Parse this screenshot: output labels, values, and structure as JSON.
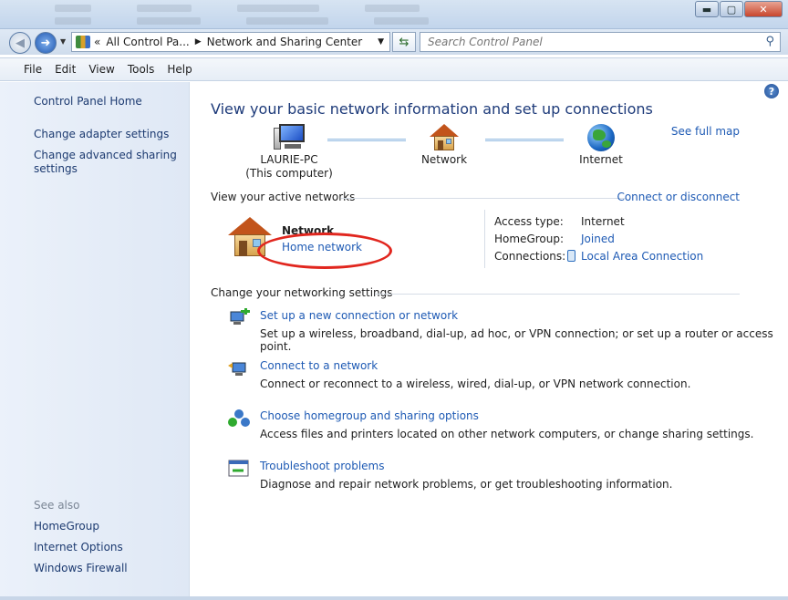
{
  "window": {
    "controls": {
      "minimize": "▬",
      "maximize": "▢",
      "close": "✕"
    }
  },
  "address": {
    "chevron": "«",
    "crumbs": [
      "All Control Pa...",
      "Network and Sharing Center"
    ],
    "search_placeholder": "Search Control Panel"
  },
  "menu": [
    "File",
    "Edit",
    "View",
    "Tools",
    "Help"
  ],
  "sidebar": {
    "home": "Control Panel Home",
    "adapter": "Change adapter settings",
    "advanced_line1": "Change advanced sharing",
    "advanced_line2": "settings",
    "see_also": "See also",
    "see_also_items": [
      "HomeGroup",
      "Internet Options",
      "Windows Firewall"
    ]
  },
  "main": {
    "heading": "View your basic network information and set up connections",
    "see_full_map": "See full map",
    "map": {
      "computer_name": "LAURIE-PC",
      "computer_sub": "(This computer)",
      "network": "Network",
      "internet": "Internet"
    },
    "active_networks_title": "View your active networks",
    "connect_or_disconnect": "Connect or disconnect",
    "active_network": {
      "name": "Network",
      "type": "Home network",
      "access_type_label": "Access type:",
      "access_type_value": "Internet",
      "homegroup_label": "HomeGroup:",
      "homegroup_value": "Joined",
      "connections_label": "Connections:",
      "connections_value": "Local Area Connection"
    },
    "settings_title": "Change your networking settings",
    "tasks": [
      {
        "link": "Set up a new connection or network",
        "desc": "Set up a wireless, broadband, dial-up, ad hoc, or VPN connection; or set up a router or access point.",
        "icon": "new-connection-icon"
      },
      {
        "link": "Connect to a network",
        "desc": "Connect or reconnect to a wireless, wired, dial-up, or VPN network connection.",
        "icon": "connect-network-icon"
      },
      {
        "link": "Choose homegroup and sharing options",
        "desc": "Access files and printers located on other network computers, or change sharing settings.",
        "icon": "homegroup-icon"
      },
      {
        "link": "Troubleshoot problems",
        "desc": "Diagnose and repair network problems, or get troubleshooting information.",
        "icon": "troubleshoot-icon"
      }
    ]
  },
  "colors": {
    "link": "#1e5ab4",
    "heading": "#1e3b7a",
    "highlight": "#e1261e",
    "sidebar_bg": "#e4ecf7"
  }
}
